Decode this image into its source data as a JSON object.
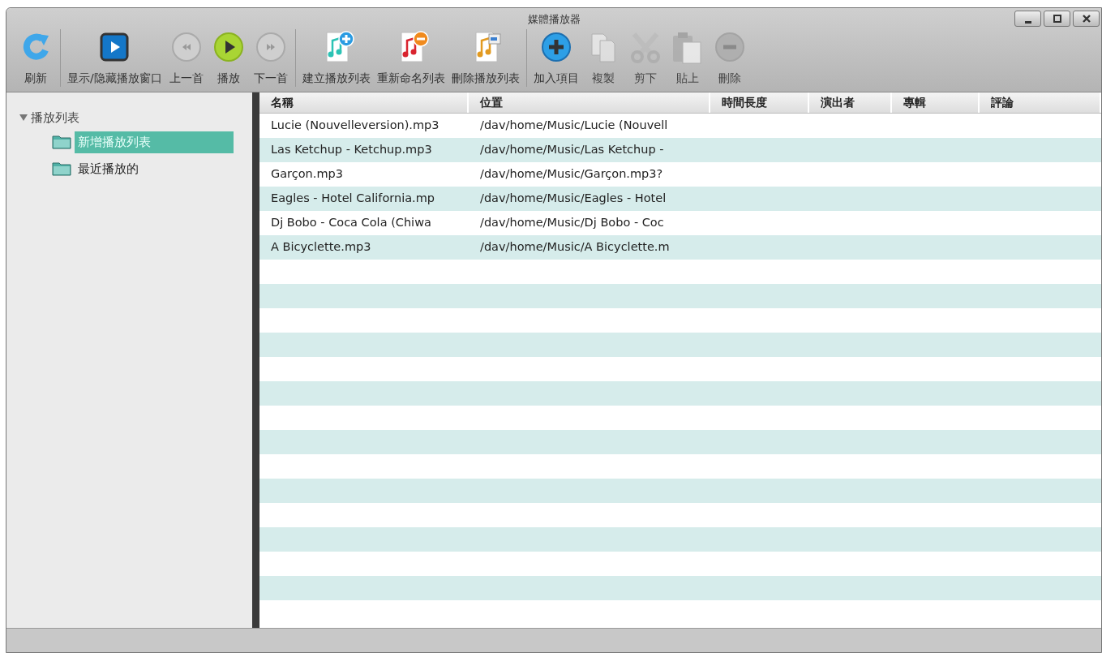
{
  "window": {
    "title": "媒體播放器",
    "controls": [
      {
        "kind": "minimize"
      },
      {
        "kind": "maximize"
      },
      {
        "kind": "close"
      }
    ]
  },
  "toolbar": {
    "groups": [
      [
        {
          "kind": "refresh",
          "label": "刷新",
          "disabled": false
        }
      ],
      [
        {
          "kind": "window",
          "label": "显示/隐藏播放窗口",
          "disabled": false
        },
        {
          "kind": "prev",
          "label": "上一首",
          "disabled": false
        },
        {
          "kind": "play",
          "label": "播放",
          "disabled": false
        },
        {
          "kind": "next",
          "label": "下一首",
          "disabled": false
        }
      ],
      [
        {
          "kind": "newlist",
          "label": "建立播放列表",
          "disabled": false
        },
        {
          "kind": "renamelist",
          "label": "重新命名列表",
          "disabled": false
        },
        {
          "kind": "deletelist",
          "label": "刪除播放列表",
          "disabled": false
        }
      ],
      [
        {
          "kind": "add",
          "label": "加入項目",
          "disabled": false
        },
        {
          "kind": "copy",
          "label": "複製",
          "disabled": true
        },
        {
          "kind": "cut",
          "label": "剪下",
          "disabled": true
        },
        {
          "kind": "paste",
          "label": "貼上",
          "disabled": true
        },
        {
          "kind": "remove",
          "label": "刪除",
          "disabled": true
        }
      ]
    ]
  },
  "sidebar": {
    "tree": [
      {
        "label": "播放列表",
        "expanded": true,
        "children": [
          {
            "label": "新增播放列表",
            "selected": true
          },
          {
            "label": "最近播放的",
            "selected": false
          }
        ]
      }
    ]
  },
  "table": {
    "columns": [
      "名稱",
      "位置",
      "時間長度",
      "演出者",
      "專輯",
      "評論"
    ],
    "rows": [
      [
        "Lucie (Nouvelleversion).mp3",
        "/dav/home/Music/Lucie (Nouvell"
      ],
      [
        "Las Ketchup - Ketchup.mp3",
        "/dav/home/Music/Las Ketchup - "
      ],
      [
        "Garçon.mp3",
        "/dav/home/Music/Garçon.mp3?"
      ],
      [
        "Eagles - Hotel California.mp",
        "/dav/home/Music/Eagles - Hotel"
      ],
      [
        "Dj Bobo - Coca Cola (Chiwa",
        "/dav/home/Music/Dj Bobo - Coc"
      ],
      [
        "A Bicyclette.mp3",
        "/dav/home/Music/A Bicyclette.m"
      ]
    ]
  }
}
